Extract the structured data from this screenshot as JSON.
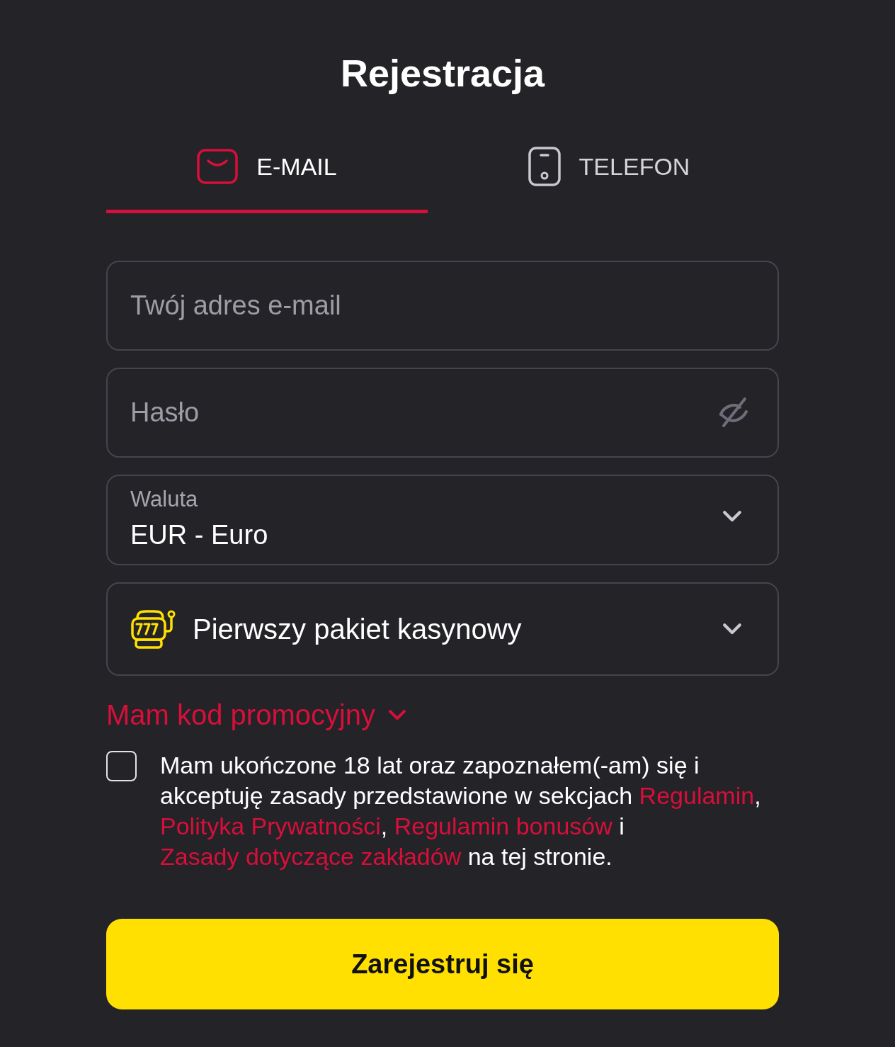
{
  "title": "Rejestracja",
  "tabs": [
    {
      "kind": "email",
      "label": "E-MAIL",
      "selected": true
    },
    {
      "kind": "phone",
      "label": "TELEFON",
      "selected": false
    }
  ],
  "fields": [
    {
      "kind": "text",
      "placeholder": "Twój adres e-mail"
    },
    {
      "kind": "password",
      "placeholder": "Hasło"
    },
    {
      "kind": "select",
      "label": "Waluta",
      "value": "EUR - Euro"
    },
    {
      "kind": "bonus",
      "value": "Pierwszy pakiet kasynowy"
    }
  ],
  "promo": {
    "label": "Mam kod promocyjny",
    "expanded": false
  },
  "consent": {
    "checked": false,
    "parts": [
      {
        "kind": "text",
        "text": "Mam ukończone 18 lat oraz zapoznałem(-am) się i akceptuję zasady przedstawione w sekcjach "
      },
      {
        "kind": "link",
        "text": "Regulamin"
      },
      {
        "kind": "text",
        "text": ", "
      },
      {
        "kind": "link",
        "text": "Polityka Prywatności"
      },
      {
        "kind": "text",
        "text": ", "
      },
      {
        "kind": "link",
        "text": "Regulamin bonusów"
      },
      {
        "kind": "text",
        "text": " i "
      },
      {
        "kind": "link",
        "text": "Zasady dotyczące zakładów"
      },
      {
        "kind": "text",
        "text": " na tej stronie."
      }
    ]
  },
  "submit": {
    "label": "Zarejestruj się"
  }
}
